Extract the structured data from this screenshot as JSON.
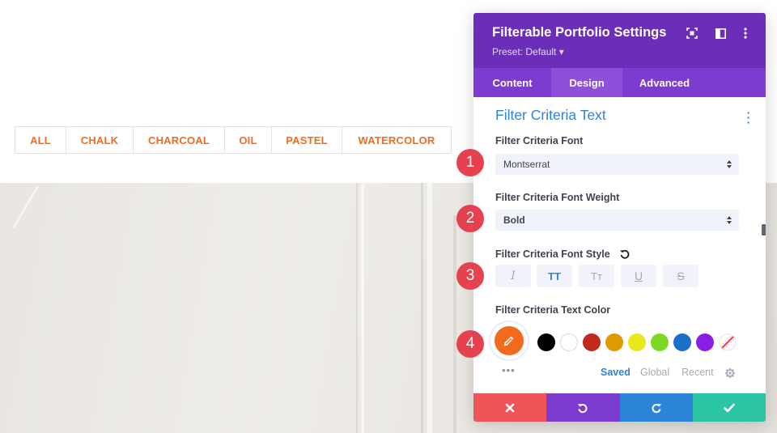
{
  "filters": [
    "ALL",
    "CHALK",
    "CHARCOAL",
    "OIL",
    "PASTEL",
    "WATERCOLOR"
  ],
  "panel": {
    "title": "Filterable Portfolio Settings",
    "preset": "Preset: Default ▾",
    "header_icons": [
      "expand-icon",
      "sidebar-toggle-icon",
      "more-vertical-icon"
    ],
    "tabs": [
      "Content",
      "Design",
      "Advanced"
    ],
    "active_tab": "Design",
    "section_title": "Filter Criteria Text",
    "fields": {
      "font_label": "Filter Criteria Font",
      "font_value": "Montserrat",
      "weight_label": "Filter Criteria Font Weight",
      "weight_value": "Bold",
      "style_label": "Filter Criteria Font Style",
      "style_buttons": [
        "I",
        "TT",
        "Tт",
        "U",
        "S"
      ],
      "style_active": "TT",
      "color_label": "Filter Criteria Text Color"
    },
    "selected_color": "#f26b1d",
    "swatches": [
      "#000000",
      "#ffffff",
      "#c0291b",
      "#e09900",
      "#e8e81a",
      "#7cda24",
      "#1a70c9",
      "#8a1ee5"
    ],
    "palette_tabs": [
      "Saved",
      "Global",
      "Recent"
    ],
    "palette_active": "Saved",
    "footer": {
      "buttons": [
        "cancel",
        "undo",
        "redo",
        "save"
      ],
      "colors": [
        "#ef5557",
        "#7d3ccf",
        "#2d85d9",
        "#2bc4a4"
      ]
    }
  },
  "callouts": [
    "1",
    "2",
    "3",
    "4"
  ],
  "accent": "#f26b1d"
}
